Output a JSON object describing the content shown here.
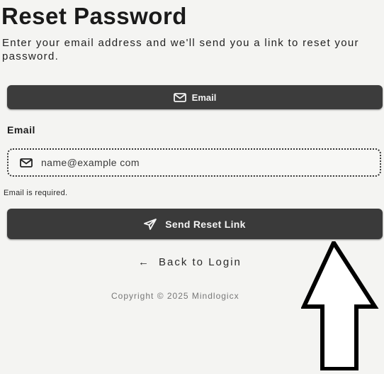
{
  "page": {
    "title": "Reset Password",
    "description": "Enter your email address and we'll send you a link to reset your password."
  },
  "method_tab": {
    "label": "Email",
    "icon": "envelope-icon"
  },
  "form": {
    "email_label": "Email",
    "email_placeholder": "name@example com",
    "email_value": "",
    "email_icon": "envelope-icon",
    "error_message": "Email is required.",
    "submit_label": "Send Reset Link",
    "submit_icon": "send-icon"
  },
  "footer": {
    "back_label": "Back to Login",
    "back_icon": "arrow-left-icon",
    "copyright": "Copyright © 2025 Mindlogicx"
  },
  "annotation": {
    "type": "up-arrow-outline"
  },
  "colors": {
    "background": "#f4f4f2",
    "button": "#3a3a3a",
    "button_text": "#f4f4f4",
    "text": "#1c1c1c"
  }
}
